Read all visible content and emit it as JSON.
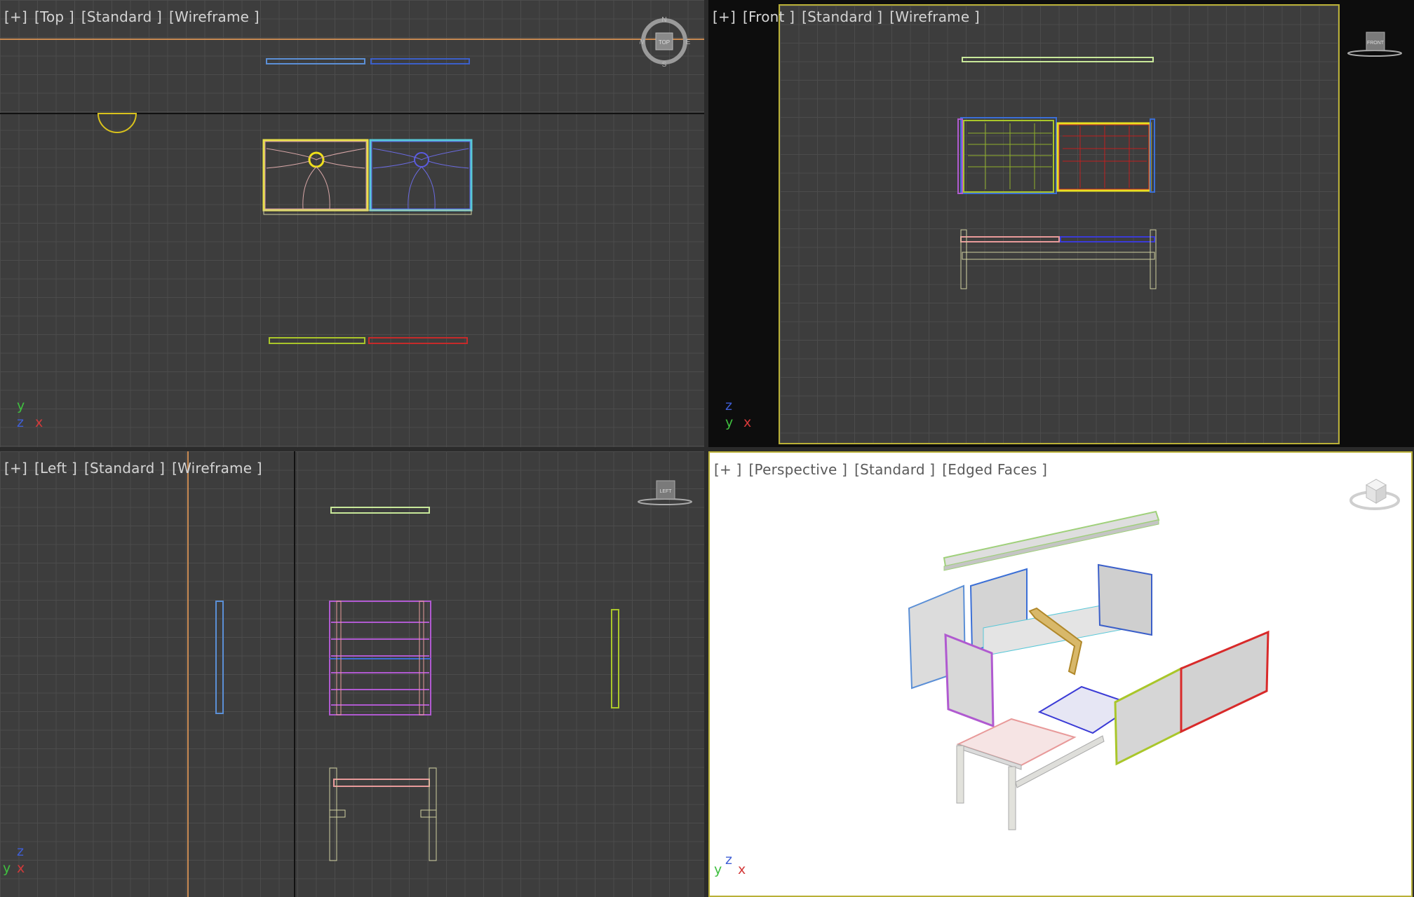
{
  "viewports": {
    "top": {
      "plus": "[+]",
      "view": "[Top ]",
      "shading_std": "[Standard ]",
      "mode": "[Wireframe ]"
    },
    "front": {
      "plus": "[+]",
      "view": "[Front ]",
      "shading_std": "[Standard ]",
      "mode": "[Wireframe ]"
    },
    "left": {
      "plus": "[+]",
      "view": "[Left ]",
      "shading_std": "[Standard ]",
      "mode": "[Wireframe ]"
    },
    "persp": {
      "plus": "[+ ]",
      "view": "[Perspective ]",
      "shading_std": "[Standard ]",
      "mode": "[Edged Faces ]"
    }
  },
  "compass": {
    "n": "N",
    "s": "S",
    "e": "E",
    "w": "W",
    "face": "TOP"
  },
  "viewcube": {
    "front": "FRONT",
    "left": "LEFT"
  },
  "axes": {
    "top": {
      "v": "y",
      "a": "z",
      "h": "x"
    },
    "front": {
      "v": "z",
      "a": "y",
      "h": "x"
    },
    "left": {
      "v": "z",
      "a": "y",
      "h": "x"
    },
    "persp": {
      "a": "y",
      "v": "z",
      "h": "x"
    }
  },
  "colors": {
    "x_axis": "#d33a3a",
    "y_axis": "#3fbf3f",
    "z_axis": "#3f5fd6",
    "active_border": "#b9b037"
  }
}
